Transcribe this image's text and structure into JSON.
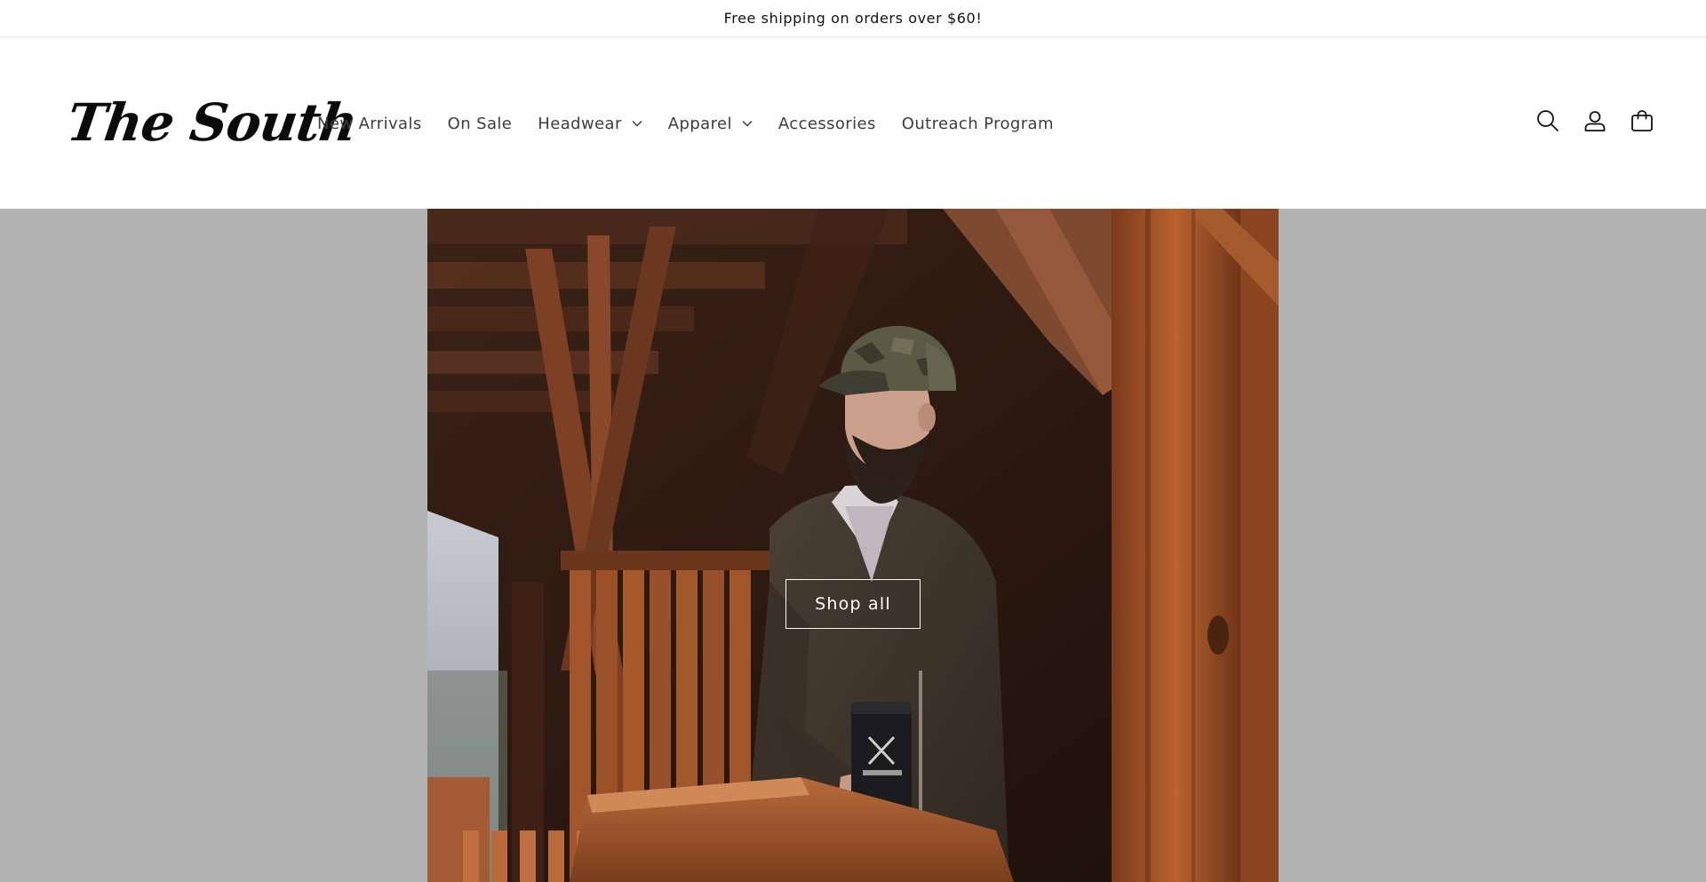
{
  "announcement": {
    "text": "Free shipping on orders over $60!"
  },
  "header": {
    "logo_text": "The South",
    "nav": [
      {
        "label": "New Arrivals",
        "has_dropdown": false
      },
      {
        "label": "On Sale",
        "has_dropdown": false
      },
      {
        "label": "Headwear",
        "has_dropdown": true
      },
      {
        "label": "Apparel",
        "has_dropdown": true
      },
      {
        "label": "Accessories",
        "has_dropdown": false
      },
      {
        "label": "Outreach Program",
        "has_dropdown": false
      }
    ],
    "icons": [
      "search-icon",
      "account-icon",
      "cart-icon"
    ]
  },
  "hero": {
    "button_label": "Shop all",
    "background_color": "#b3b3b3"
  },
  "colors": {
    "text": "#121212",
    "nav_text": "#3d3d3d",
    "border": "#e6e6e6",
    "button_border": "#ffffff"
  }
}
